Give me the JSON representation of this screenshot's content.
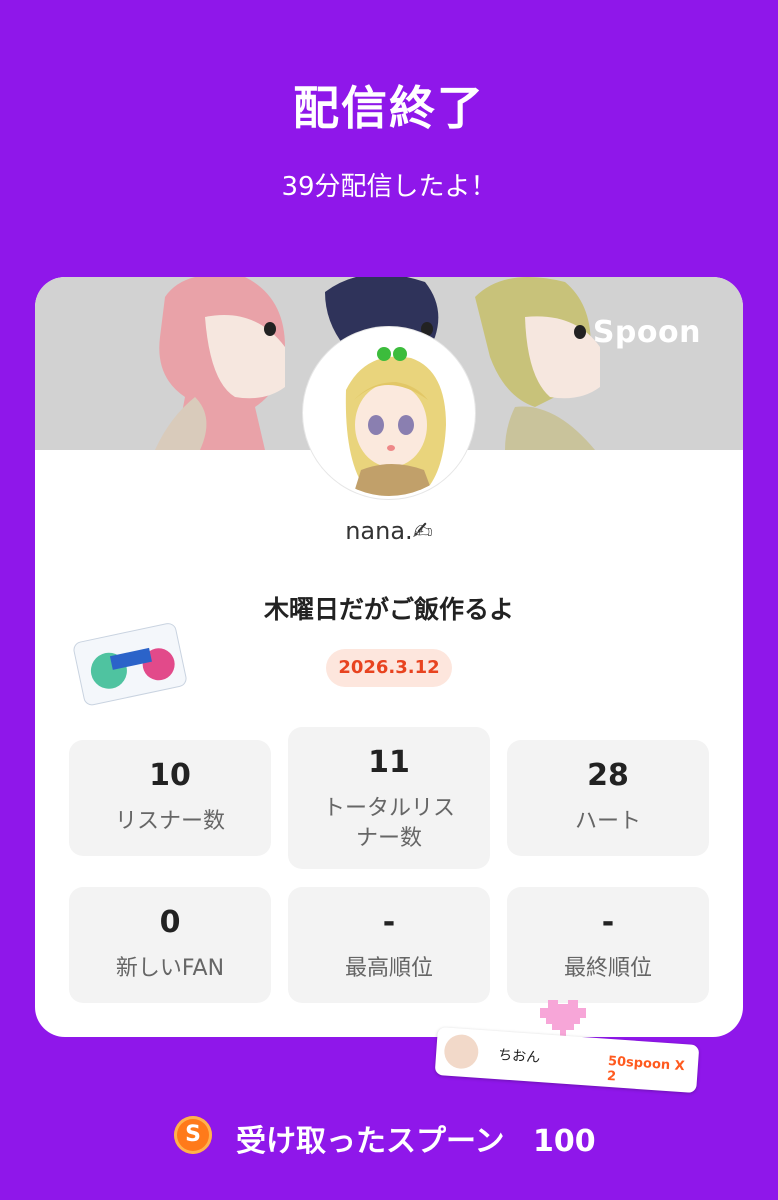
{
  "header": {
    "title": "配信終了",
    "subtitle": "39分配信したよ！"
  },
  "card": {
    "brand": "Spoon",
    "username": "nana.✍",
    "stream_title": "木曜日だがご飯作るよ",
    "date": "2026.3.12",
    "stats": [
      {
        "value": "10",
        "label": "リスナー数"
      },
      {
        "value": "11",
        "label": "トータルリスナー数"
      },
      {
        "value": "28",
        "label": "ハート"
      },
      {
        "value": "0",
        "label": "新しいFAN"
      },
      {
        "value": "-",
        "label": "最高順位"
      },
      {
        "value": "-",
        "label": "最終順位"
      }
    ]
  },
  "gift": {
    "name": "ちおん",
    "amount": "50spoon X 2"
  },
  "footer": {
    "coin_icon": "S",
    "label": "受け取ったスプーン",
    "value": "100"
  },
  "colors": {
    "background": "#8f17ea",
    "accent": "#e8431f",
    "coin": "#ff7a1a"
  }
}
